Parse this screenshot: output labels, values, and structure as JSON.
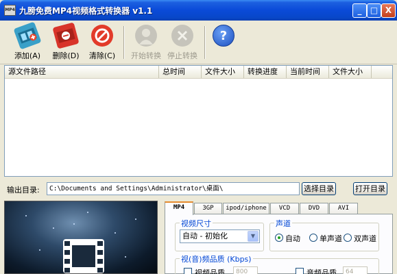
{
  "window": {
    "title": "九膀免费MP4视频格式转换器 v1.1",
    "icon_text": "MP4",
    "controls": [
      "_",
      "□",
      "X"
    ]
  },
  "toolbar": {
    "buttons": [
      {
        "label": "添加(A)",
        "icon": "film-add-icon",
        "enabled": true
      },
      {
        "label": "删除(D)",
        "icon": "film-delete-icon",
        "enabled": true
      },
      {
        "label": "清除(C)",
        "icon": "clear-icon",
        "enabled": true
      },
      {
        "label": "开始转换",
        "icon": "person-start-icon",
        "enabled": false
      },
      {
        "label": "停止转换",
        "icon": "stop-icon",
        "enabled": false
      },
      {
        "label": "?",
        "icon": "help-icon",
        "enabled": true
      }
    ]
  },
  "file_list": {
    "columns": [
      "源文件路径",
      "总时间",
      "文件大小",
      "转换进度",
      "当前时间",
      "文件大小"
    ],
    "rows": []
  },
  "output": {
    "label": "输出目录:",
    "path": "C:\\Documents and Settings\\Administrator\\桌面\\",
    "choose_button": "选择目录",
    "open_button": "打开目录"
  },
  "tabs": [
    "MP4",
    "3GP",
    "ipod/iphone",
    "VCD",
    "DVD",
    "AVI"
  ],
  "active_tab": "MP4",
  "settings": {
    "video_size": {
      "title": "视频尺寸",
      "selected": "自动 - 初始化"
    },
    "audio_channel": {
      "title": "声道",
      "options": [
        "自动",
        "单声道",
        "双声道"
      ],
      "selected": "自动"
    },
    "quality": {
      "title": "视(音)频品质 (Kbps)",
      "video_quality_label": "视频品质",
      "video_quality_value": "800",
      "audio_quality_label": "音频品质",
      "audio_quality_value": "64"
    }
  },
  "colors": {
    "title_bar": "#0a4ad8",
    "group_title": "#0046d5",
    "tab_highlight": "#e68b2c"
  }
}
